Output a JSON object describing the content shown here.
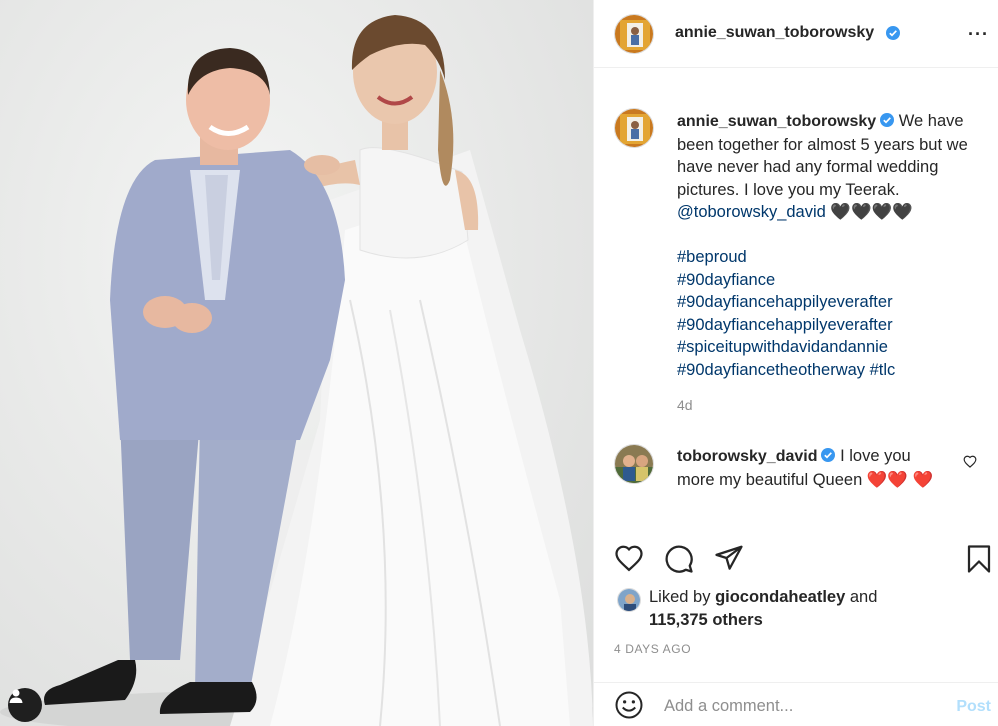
{
  "post": {
    "author": "annie_suwan_toborowsky",
    "caption_text": "We have been together for almost 5 years but we have never had any formal wedding pictures. I love you my Teerak.",
    "caption_mention": "@toborowsky_david",
    "caption_emojis": "🖤🖤🖤🖤",
    "hashtags": [
      "#beproud",
      "#90dayfiance",
      "#90dayfiancehappilyeverafter",
      "#90dayfiancehappilyeverafter",
      "#spiceitupwithdavidandannie",
      "#90dayfiancetheotherway #tlc"
    ],
    "time_ago": "4d"
  },
  "comment": {
    "author": "toborowsky_david",
    "text": "I love you more my beautiful Queen",
    "emojis": "❤️❤️ ❤️"
  },
  "likes": {
    "prefix": "Liked by",
    "user": "giocondaheatley",
    "and": "and",
    "count": "115,375 others"
  },
  "date": "4 DAYS AGO",
  "comment_box": {
    "placeholder": "Add a comment...",
    "post_label": "Post"
  },
  "header": {
    "more": "···"
  },
  "colors": {
    "link": "#00376b",
    "verified": "#3897f0",
    "post_disabled": "#b2dffc"
  },
  "icons": [
    "more-options-icon",
    "verified-icon",
    "heart-icon",
    "comment-icon",
    "share-icon",
    "bookmark-icon",
    "emoji-icon",
    "user-tag-icon"
  ]
}
